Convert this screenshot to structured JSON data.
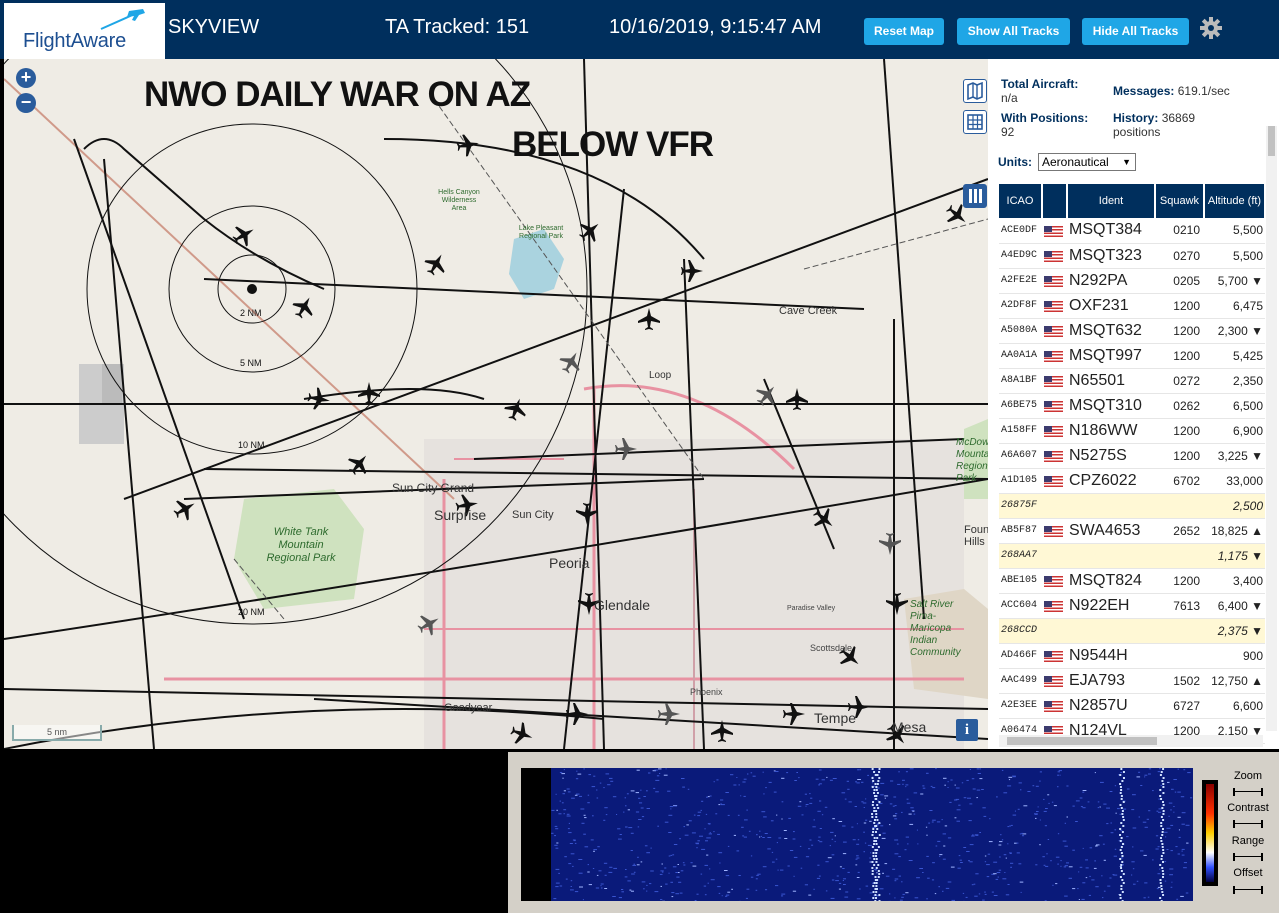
{
  "header": {
    "logo_text": "FlightAware",
    "app_name": "SKYVIEW",
    "tracked": "TA Tracked: 151",
    "datetime": "10/16/2019, 9:15:47 AM",
    "reset_map": "Reset Map",
    "show_all": "Show All Tracks",
    "hide_all": "Hide All Tracks"
  },
  "map": {
    "overlay_title1": "NWO DAILY WAR ON AZ",
    "overlay_title2": "BELOW VFR",
    "ring_labels": [
      "2 NM",
      "5 NM",
      "10 NM",
      "20 NM"
    ],
    "places": [
      "Cave Creek",
      "Sun City Grand",
      "Surprise",
      "Sun City",
      "Peoria",
      "Glendale",
      "White Tank Mountain Regional Park",
      "Scottsdale",
      "Phoenix",
      "Goodyear",
      "Tempe",
      "Mesa",
      "Lake Pleasant Regional Park",
      "Hells Canyon Wilderness Area",
      "McDowell Mountain Regional Park",
      "Loop",
      "Fountain Hills",
      "Paradise Valley",
      "Salt River Pima-Maricopa Indian Community"
    ],
    "scale_label": "5 nm",
    "info": "i"
  },
  "stats": {
    "total_label": "Total Aircraft:",
    "total_value": "n/a",
    "messages_label": "Messages:",
    "messages_value": "619.1/sec",
    "positions_label": "With Positions:",
    "positions_value": "92",
    "history_label": "History:",
    "history_value": "36869 positions",
    "units_label": "Units:",
    "units_value": "Aeronautical"
  },
  "table": {
    "headers": [
      "ICAO",
      "",
      "Ident",
      "Squawk",
      "Altitude (ft)"
    ],
    "rows": [
      {
        "icao": "ACE0DF",
        "ident": "MSQT384",
        "squawk": "0210",
        "alt": "5,500",
        "flag": true,
        "nopos": false
      },
      {
        "icao": "A4ED9C",
        "ident": "MSQT323",
        "squawk": "0270",
        "alt": "5,500",
        "flag": true,
        "nopos": false
      },
      {
        "icao": "A2FE2E",
        "ident": "N292PA",
        "squawk": "0205",
        "alt": "5,700 ▼",
        "flag": true,
        "nopos": false
      },
      {
        "icao": "A2DF8F",
        "ident": "OXF231",
        "squawk": "1200",
        "alt": "6,475",
        "flag": true,
        "nopos": false
      },
      {
        "icao": "A5080A",
        "ident": "MSQT632",
        "squawk": "1200",
        "alt": "2,300 ▼",
        "flag": true,
        "nopos": false
      },
      {
        "icao": "AA0A1A",
        "ident": "MSQT997",
        "squawk": "1200",
        "alt": "5,425",
        "flag": true,
        "nopos": false
      },
      {
        "icao": "A8A1BF",
        "ident": "N65501",
        "squawk": "0272",
        "alt": "2,350",
        "flag": true,
        "nopos": false
      },
      {
        "icao": "A6BE75",
        "ident": "MSQT310",
        "squawk": "0262",
        "alt": "6,500",
        "flag": true,
        "nopos": false
      },
      {
        "icao": "A158FF",
        "ident": "N186WW",
        "squawk": "1200",
        "alt": "6,900",
        "flag": true,
        "nopos": false
      },
      {
        "icao": "A6A607",
        "ident": "N5275S",
        "squawk": "1200",
        "alt": "3,225 ▼",
        "flag": true,
        "nopos": false
      },
      {
        "icao": "A1D105",
        "ident": "CPZ6022",
        "squawk": "6702",
        "alt": "33,000",
        "flag": true,
        "nopos": false
      },
      {
        "icao": "26875F",
        "ident": "",
        "squawk": "",
        "alt": "2,500",
        "flag": false,
        "nopos": true
      },
      {
        "icao": "AB5F87",
        "ident": "SWA4653",
        "squawk": "2652",
        "alt": "18,825 ▲",
        "flag": true,
        "nopos": false
      },
      {
        "icao": "268AA7",
        "ident": "",
        "squawk": "",
        "alt": "1,175 ▼",
        "flag": false,
        "nopos": true
      },
      {
        "icao": "ABE105",
        "ident": "MSQT824",
        "squawk": "1200",
        "alt": "3,400",
        "flag": true,
        "nopos": false
      },
      {
        "icao": "ACC604",
        "ident": "N922EH",
        "squawk": "7613",
        "alt": "6,400 ▼",
        "flag": true,
        "nopos": false
      },
      {
        "icao": "268CCD",
        "ident": "",
        "squawk": "",
        "alt": "2,375 ▼",
        "flag": false,
        "nopos": true
      },
      {
        "icao": "AD466F",
        "ident": "N9544H",
        "squawk": "",
        "alt": "900",
        "flag": true,
        "nopos": false
      },
      {
        "icao": "AAC499",
        "ident": "EJA793",
        "squawk": "1502",
        "alt": "12,750 ▲",
        "flag": true,
        "nopos": false
      },
      {
        "icao": "A2E3EE",
        "ident": "N2857U",
        "squawk": "6727",
        "alt": "6,600",
        "flag": true,
        "nopos": false
      },
      {
        "icao": "A06474",
        "ident": "N124VL",
        "squawk": "1200",
        "alt": "2,150 ▼",
        "flag": true,
        "nopos": false
      }
    ]
  },
  "spectrum": {
    "zoom": "Zoom",
    "contrast": "Contrast",
    "range": "Range",
    "offset": "Offset"
  },
  "icons": [
    "plus-icon",
    "minus-icon",
    "map-icon",
    "grid-icon",
    "columns-icon",
    "gear-icon",
    "info-icon",
    "airplane-icon"
  ]
}
